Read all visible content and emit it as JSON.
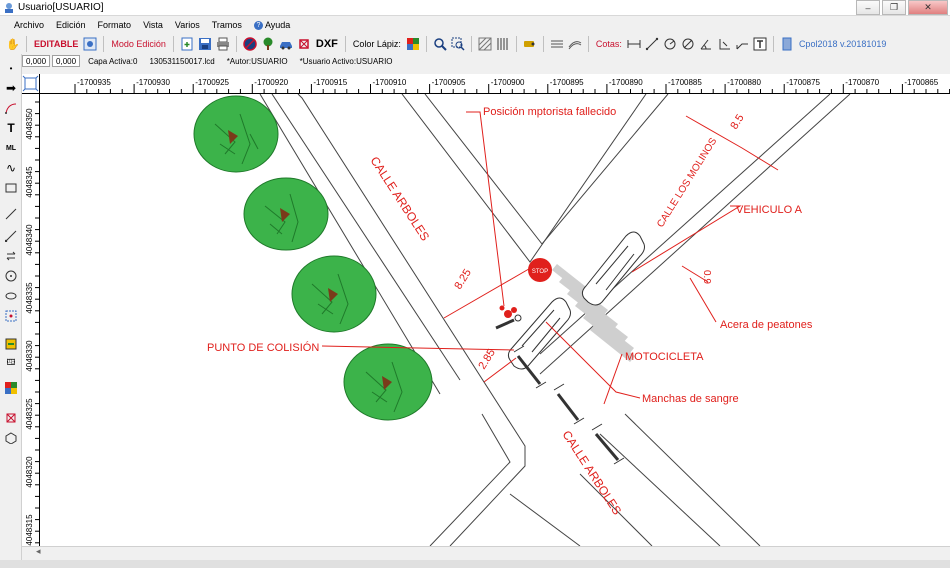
{
  "window": {
    "title": "Usuario[USUARIO]",
    "minimize": "–",
    "maximize": "❐",
    "close": "✕"
  },
  "menu": [
    "Archivo",
    "Edición",
    "Formato",
    "Vista",
    "Varios",
    "Tramos",
    "Ayuda"
  ],
  "toolbar": {
    "editable": "EDITABLE",
    "mode": "Modo Edición",
    "dxf": "DXF",
    "color_label": "Color Lápiz:",
    "cotas": "Cotas:",
    "version": "Cpol2018 v.20181019"
  },
  "status": {
    "x": "0,000",
    "y": "0,000",
    "layer": "Capa Activa:0",
    "file": "130531150017.lcd",
    "author": "*Autor:USUARIO",
    "user": "*Usuario Activo:USUARIO"
  },
  "ruler_x": [
    "-1700935",
    "-1700930",
    "-1700925",
    "-1700920",
    "-1700915",
    "-1700910",
    "-1700905",
    "-1700900",
    "-1700895",
    "-1700890",
    "-1700885",
    "-1700880",
    "-1700875",
    "-1700870",
    "-1700865"
  ],
  "ruler_y": [
    "4048350",
    "4048345",
    "4048340",
    "4048335",
    "4048330",
    "4048325",
    "4048320",
    "4048315"
  ],
  "drawing": {
    "street_1": "CALLE ARBOLES",
    "street_2": "CALLE ARBOLES",
    "street_3": "CALLE LOS MOLINOS",
    "label_motorist": "Posición mptorista fallecido",
    "label_vehicle": "VEHICULO A",
    "label_sidewalk": "Acera de peatones",
    "label_collision": "PUNTO DE COLISIÓN",
    "label_motorcycle": "MOTOCICLETA",
    "label_blood": "Manchas de sangre",
    "dim_1": "8.5",
    "dim_2": "0.9",
    "dim_3": "8.25",
    "dim_4": "2.85",
    "stop_sign": "STOP"
  },
  "colors": {
    "annotation": "#e0201c",
    "tree": "#3cb34a",
    "tree_dark": "#1f7a2a",
    "trunk": "#7a3b1a"
  }
}
